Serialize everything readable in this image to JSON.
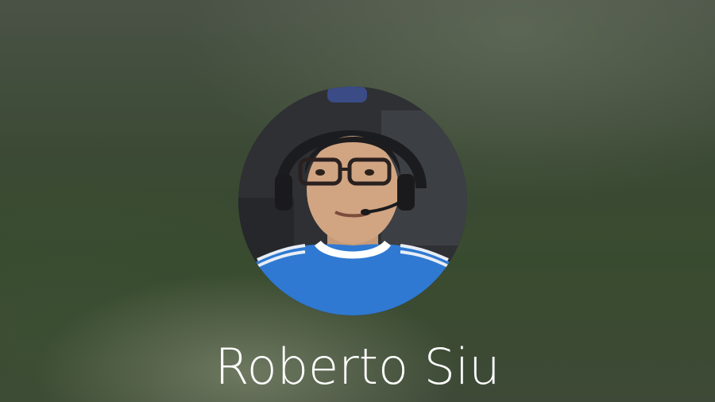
{
  "lock_screen": {
    "user_name": "Roberto Siu",
    "avatar_icon": "user-photo",
    "colors": {
      "name_text": "#ffffff",
      "shirt": "#2f79d2",
      "background": "#3b4a34"
    }
  }
}
